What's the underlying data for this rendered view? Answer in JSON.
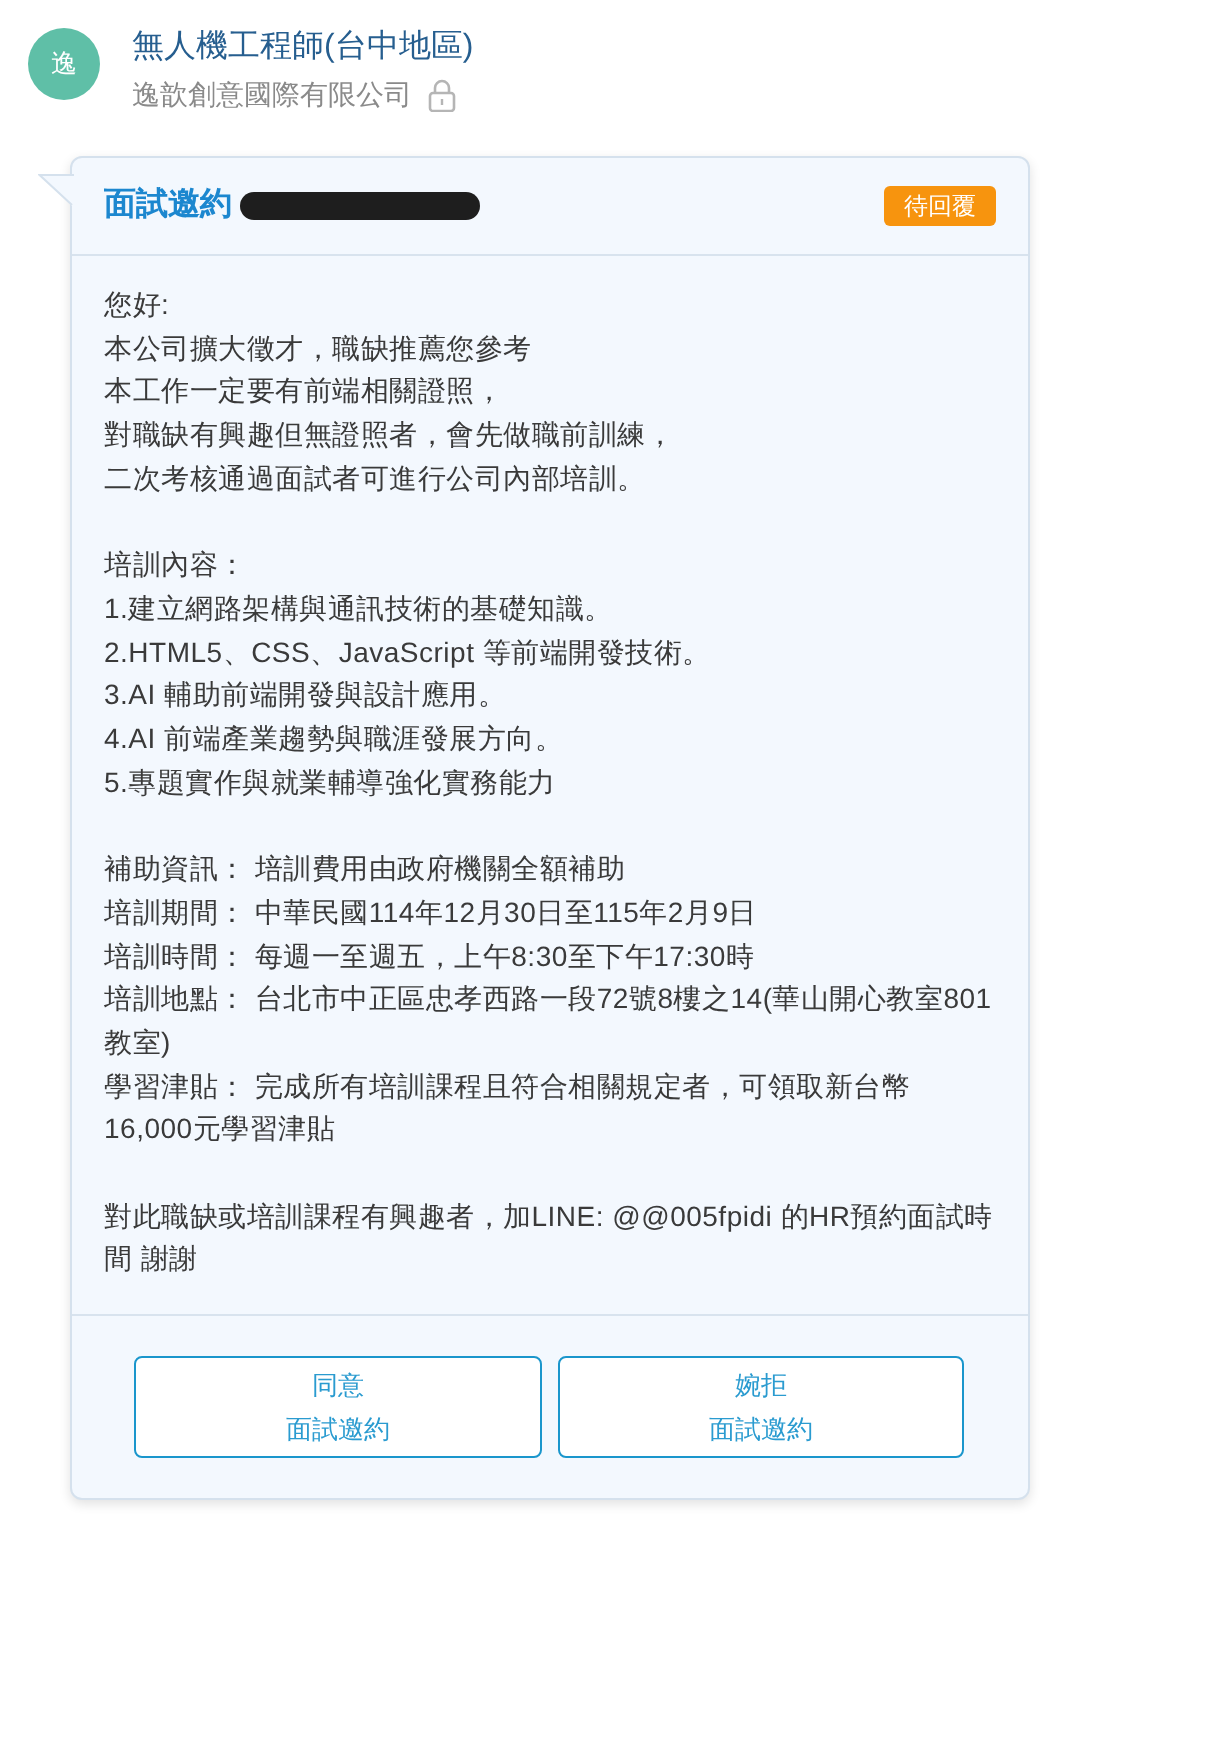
{
  "header": {
    "avatar_text": "逸",
    "job_title": "無人機工程師(台中地區)",
    "company": "逸歆創意國際有限公司"
  },
  "card": {
    "title": "面試邀約",
    "status_badge": "待回覆",
    "paragraphs": [
      [
        "您好:",
        "本公司擴大徵才，職缺推薦您參考",
        "本工作一定要有前端相關證照，",
        "對職缺有興趣但無證照者，會先做職前訓練，",
        "二次考核通過面試者可進行公司內部培訓。"
      ],
      [
        "培訓內容：",
        "1.建立網路架構與通訊技術的基礎知識。",
        "2.HTML5、CSS、JavaScript 等前端開發技術。",
        "3.AI 輔助前端開發與設計應用。",
        "4.AI 前端產業趨勢與職涯發展方向。",
        "5.專題實作與就業輔導強化實務能力"
      ],
      [
        "補助資訊： 培訓費用由政府機關全額補助",
        "培訓期間： 中華民國114年12月30日至115年2月9日",
        "培訓時間： 每週一至週五，上午8:30至下午17:30時",
        "培訓地點： 台北市中正區忠孝西路一段72號8樓之14(華山開心教室801教室)",
        "學習津貼： 完成所有培訓課程且符合相關規定者，可領取新台幣16,000元學習津貼"
      ],
      [
        "對此職缺或培訓課程有興趣者，加LINE: @@005fpidi 的HR預約面試時間 謝謝"
      ]
    ],
    "buttons": [
      {
        "lines": [
          "同意",
          "面試邀約"
        ]
      },
      {
        "lines": [
          "婉拒",
          "面試邀約"
        ]
      }
    ]
  }
}
